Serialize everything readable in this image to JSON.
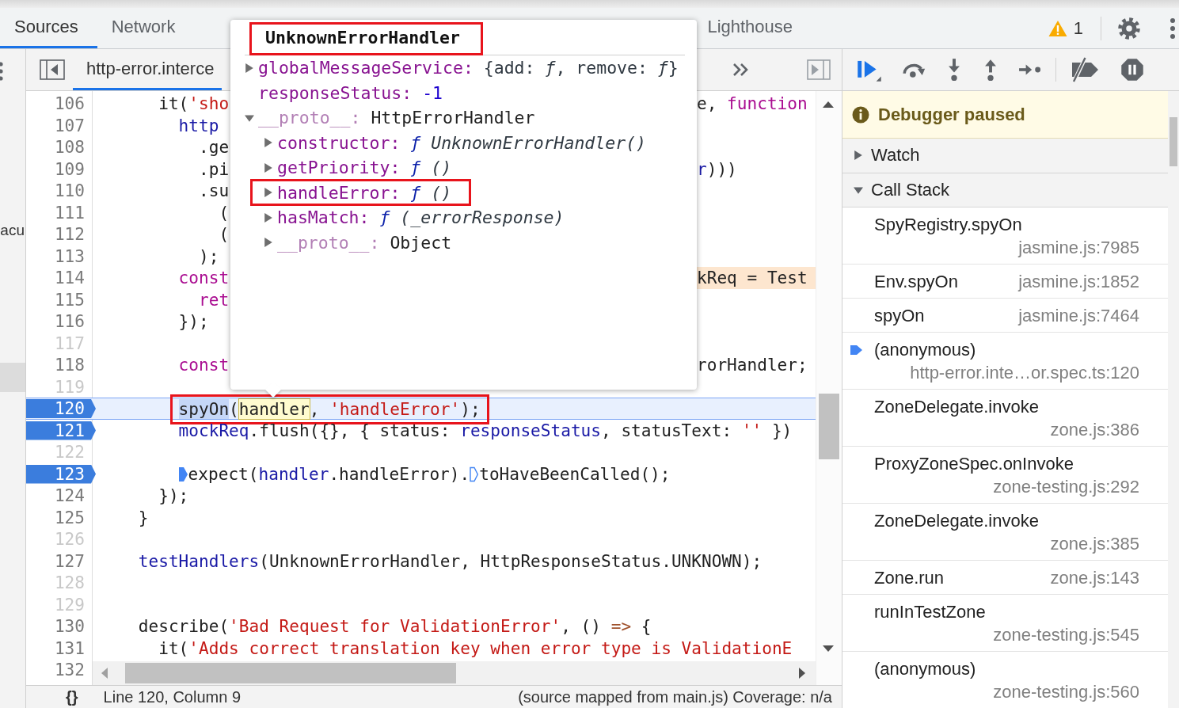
{
  "main_tabs": [
    {
      "label": "Sources",
      "selected": true
    },
    {
      "label": "Network",
      "selected": false
    },
    {
      "label": "Lighthouse",
      "selected": false
    }
  ],
  "issues": {
    "count": "1"
  },
  "navigator": {
    "items": [
      {
        "label": "acu",
        "selected": false
      }
    ]
  },
  "editor": {
    "file_tab": {
      "label": "http-error.interce",
      "selected": true
    },
    "lines": [
      {
        "number": "106",
        "kind": "plain",
        "current": false,
        "outlined": false,
        "code": [
          {
            "text": "      it(",
            "kind": "plain"
          },
          {
            "text": "'sho",
            "kind": "string"
          }
        ],
        "tail": [
          {
            "text": "e, ",
            "kind": "plain"
          },
          {
            "text": "function",
            "kind": "keyword"
          }
        ],
        "tail_highlight": false
      },
      {
        "number": "107",
        "kind": "plain",
        "current": false,
        "outlined": false,
        "code": [
          {
            "text": "        http",
            "kind": "variable"
          }
        ]
      },
      {
        "number": "108",
        "kind": "plain",
        "current": false,
        "outlined": false,
        "code": [
          {
            "text": "          .ge",
            "kind": "plain"
          }
        ]
      },
      {
        "number": "109",
        "kind": "plain",
        "current": false,
        "outlined": false,
        "code": [
          {
            "text": "          .pi",
            "kind": "plain"
          }
        ],
        "tail": [
          {
            "text": "r",
            "kind": "variable"
          },
          {
            "text": ")))",
            "kind": "plain"
          }
        ],
        "tail_highlight": false
      },
      {
        "number": "110",
        "kind": "plain",
        "current": false,
        "outlined": false,
        "code": [
          {
            "text": "          .su",
            "kind": "plain"
          }
        ]
      },
      {
        "number": "111",
        "kind": "plain",
        "current": false,
        "outlined": false,
        "code": [
          {
            "text": "            (",
            "kind": "plain"
          }
        ]
      },
      {
        "number": "112",
        "kind": "plain",
        "current": false,
        "outlined": false,
        "code": [
          {
            "text": "            (",
            "kind": "plain"
          }
        ]
      },
      {
        "number": "113",
        "kind": "plain",
        "current": false,
        "outlined": false,
        "code": [
          {
            "text": "          );",
            "kind": "plain"
          }
        ]
      },
      {
        "number": "114",
        "kind": "plain",
        "current": false,
        "outlined": false,
        "code": [
          {
            "text": "        const",
            "kind": "keyword"
          }
        ],
        "tail": [
          {
            "text": "kReq = Test",
            "kind": "plain"
          }
        ],
        "tail_highlight": true
      },
      {
        "number": "115",
        "kind": "plain",
        "current": false,
        "outlined": false,
        "code": [
          {
            "text": "          ret",
            "kind": "keyword"
          }
        ]
      },
      {
        "number": "116",
        "kind": "plain",
        "current": false,
        "outlined": false,
        "code": [
          {
            "text": "        });",
            "kind": "plain"
          }
        ]
      },
      {
        "number": "117",
        "kind": "dim",
        "current": false,
        "outlined": false
      },
      {
        "number": "118",
        "kind": "plain",
        "current": false,
        "outlined": false,
        "code": [
          {
            "text": "        const",
            "kind": "keyword"
          }
        ],
        "tail": [
          {
            "text": "rorHandler;",
            "kind": "plain"
          }
        ],
        "tail_highlight": false
      },
      {
        "number": "119",
        "kind": "dim",
        "current": false,
        "outlined": false
      },
      {
        "number": "120",
        "kind": "breakpoint",
        "current": true,
        "outlined": true,
        "code": [
          {
            "text": "        spyOn",
            "kind": "plain",
            "selected": true
          },
          {
            "text": "(",
            "kind": "plain"
          },
          {
            "text": "handler",
            "kind": "plain",
            "hovered": true
          },
          {
            "text": ", ",
            "kind": "plain"
          },
          {
            "text": "'handleError'",
            "kind": "string"
          },
          {
            "text": ");",
            "kind": "plain"
          }
        ]
      },
      {
        "number": "121",
        "kind": "breakpoint",
        "current": false,
        "outlined": false,
        "code": [
          {
            "text": "        mockReq",
            "kind": "variable"
          },
          {
            "text": ".flush({}, { status: ",
            "kind": "plain"
          },
          {
            "text": "responseStatus",
            "kind": "variable"
          },
          {
            "text": ", statusText: ",
            "kind": "plain"
          },
          {
            "text": "''",
            "kind": "string"
          },
          {
            "text": " })",
            "kind": "plain"
          }
        ]
      },
      {
        "number": "122",
        "kind": "dim",
        "current": false,
        "outlined": false
      },
      {
        "number": "123",
        "kind": "breakpoint",
        "current": false,
        "outlined": false,
        "code": [
          {
            "text": "        expect(",
            "kind": "plain",
            "marker_active": true
          },
          {
            "text": "handler",
            "kind": "variable"
          },
          {
            "text": ".handleError).",
            "kind": "plain"
          },
          {
            "text": "toHaveBeenCalled();",
            "kind": "plain",
            "marker_active": false
          }
        ]
      },
      {
        "number": "124",
        "kind": "plain",
        "current": false,
        "outlined": false,
        "code": [
          {
            "text": "      });",
            "kind": "plain"
          }
        ]
      },
      {
        "number": "125",
        "kind": "plain",
        "current": false,
        "outlined": false,
        "code": [
          {
            "text": "    }",
            "kind": "plain"
          }
        ]
      },
      {
        "number": "126",
        "kind": "dim",
        "current": false,
        "outlined": false
      },
      {
        "number": "127",
        "kind": "plain",
        "current": false,
        "outlined": false,
        "code": [
          {
            "text": "    testHandlers",
            "kind": "variable"
          },
          {
            "text": "(UnknownErrorHandler, HttpResponseStatus.UNKNOWN);",
            "kind": "plain"
          }
        ]
      },
      {
        "number": "128",
        "kind": "dim",
        "current": false,
        "outlined": false
      },
      {
        "number": "129",
        "kind": "dim",
        "current": false,
        "outlined": false
      },
      {
        "number": "130",
        "kind": "plain",
        "current": false,
        "outlined": false,
        "code": [
          {
            "text": "    describe(",
            "kind": "plain"
          },
          {
            "text": "'Bad Request for ValidationError'",
            "kind": "string"
          },
          {
            "text": ", () ",
            "kind": "plain"
          },
          {
            "text": "=>",
            "kind": "operator"
          },
          {
            "text": " {",
            "kind": "plain"
          }
        ]
      },
      {
        "number": "131",
        "kind": "plain",
        "current": false,
        "outlined": false,
        "code": [
          {
            "text": "      it(",
            "kind": "plain"
          },
          {
            "text": "'Adds correct translation key when error type is ValidationE",
            "kind": "string"
          }
        ]
      },
      {
        "number": "132",
        "kind": "plain",
        "current": false,
        "outlined": false
      }
    ],
    "status": {
      "format": "{}",
      "position": "Line 120, Column 9",
      "source": "(source mapped from main.js) Coverage: n/a"
    }
  },
  "popover": {
    "title": "UnknownErrorHandler",
    "title_outlined": true,
    "properties": [
      {
        "key": "globalMessageService:",
        "kind": "object",
        "value": "{add: *ƒ*, remove: *ƒ*}",
        "expanded": false,
        "dim": false,
        "outlined": false
      },
      {
        "key": "responseStatus:",
        "kind": "number",
        "value": "-1",
        "dim": false,
        "outlined": false
      },
      {
        "key": "__proto__:",
        "kind": "class",
        "value": "HttpErrorHandler",
        "expanded": true,
        "dim": true,
        "outlined": false,
        "children": [
          {
            "key": "constructor:",
            "kind": "function",
            "mark": "ƒ",
            "value": "UnknownErrorHandler()",
            "expanded": false,
            "dim": false,
            "outlined": false
          },
          {
            "key": "getPriority:",
            "kind": "function",
            "mark": "ƒ",
            "value": "()",
            "expanded": false,
            "dim": false,
            "outlined": false
          },
          {
            "key": "handleError:",
            "kind": "function",
            "mark": "ƒ",
            "value": "()",
            "expanded": false,
            "dim": false,
            "outlined": true
          },
          {
            "key": "hasMatch:",
            "kind": "function",
            "mark": "ƒ",
            "value": "(_errorResponse)",
            "expanded": false,
            "dim": false,
            "outlined": false
          },
          {
            "key": "__proto__:",
            "kind": "class",
            "value": "Object",
            "expanded": false,
            "dim": true,
            "outlined": false
          }
        ]
      }
    ]
  },
  "debugger": {
    "banner": "Debugger paused",
    "sections": [
      {
        "label": "Watch",
        "expanded": false
      },
      {
        "label": "Call Stack",
        "expanded": true
      }
    ],
    "call_stack": [
      {
        "name": "SpyRegistry.spyOn",
        "location": "jasmine.js:7985",
        "current": false
      },
      {
        "name": "Env.spyOn",
        "location": "jasmine.js:1852",
        "current": false
      },
      {
        "name": "spyOn",
        "location": "jasmine.js:7464",
        "current": false
      },
      {
        "name": "(anonymous)",
        "location": "http-error.inte…or.spec.ts:120",
        "current": true
      },
      {
        "name": "ZoneDelegate.invoke",
        "location": "zone.js:386",
        "current": false
      },
      {
        "name": "ProxyZoneSpec.onInvoke",
        "location": "zone-testing.js:292",
        "current": false
      },
      {
        "name": "ZoneDelegate.invoke",
        "location": "zone.js:385",
        "current": false
      },
      {
        "name": "Zone.run",
        "location": "zone.js:143",
        "current": false
      },
      {
        "name": "runInTestZone",
        "location": "zone-testing.js:545",
        "current": false
      },
      {
        "name": "(anonymous)",
        "location": "zone-testing.js:560",
        "current": false
      }
    ]
  }
}
